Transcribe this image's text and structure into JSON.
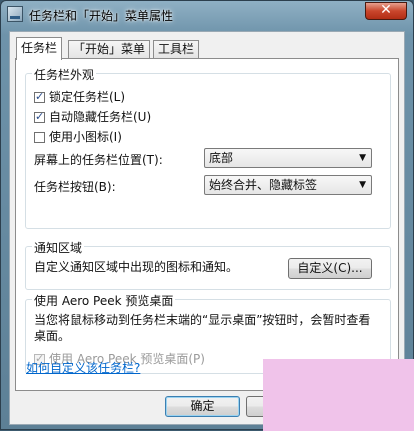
{
  "window": {
    "title": "任务栏和「开始」菜单属性",
    "close_glyph": "✕"
  },
  "tabs": [
    {
      "label": "任务栏"
    },
    {
      "label": "「开始」菜单"
    },
    {
      "label": "工具栏"
    }
  ],
  "appearance": {
    "group_title": "任务栏外观",
    "checkboxes": [
      {
        "label": "锁定任务栏(L)",
        "checked": true
      },
      {
        "label": "自动隐藏任务栏(U)",
        "checked": true
      },
      {
        "label": "使用小图标(I)",
        "checked": false
      }
    ],
    "position_label": "屏幕上的任务栏位置(T):",
    "position_value": "底部",
    "buttons_label": "任务栏按钮(B):",
    "buttons_value": "始终合并、隐藏标签"
  },
  "notification": {
    "group_title": "通知区域",
    "description": "自定义通知区域中出现的图标和通知。",
    "customize_button": "自定义(C)..."
  },
  "aero_peek": {
    "group_title": "使用 Aero Peek 预览桌面",
    "description": "当您将鼠标移动到任务栏末端的“显示桌面”按钮时，会暂时查看桌面。",
    "checkbox_label": "使用 Aero Peek 预览桌面(P)",
    "checked": true,
    "disabled": true
  },
  "help_link": "如何自定义该任务栏?",
  "footer": {
    "ok_button": "确定",
    "cancel_button": "取消"
  },
  "colors": {
    "link": "#0066cc",
    "overlay": "#f0c3ea",
    "close_button": "#c9462c"
  },
  "icons": {
    "title_icon": "taskbar-properties-icon",
    "dropdown_icon": "chevron-down-icon",
    "check_icon": "checkmark-icon"
  }
}
